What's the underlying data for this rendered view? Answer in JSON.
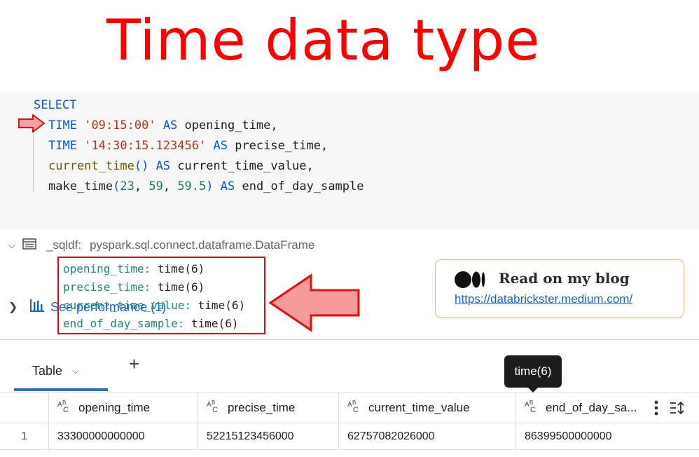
{
  "title": "Time data type",
  "code": {
    "select": "SELECT",
    "lines": [
      {
        "kw": "TIME",
        "str": "'09:15:00'",
        "as": "AS",
        "alias": "opening_time,"
      },
      {
        "kw": "TIME",
        "str": "'14:30:15.123456'",
        "as": "AS",
        "alias": "precise_time,"
      },
      {
        "fn": "current_time",
        "paren": "()",
        "as": "AS",
        "alias": "current_time_value,"
      },
      {
        "fn": "make_time",
        "open": "(",
        "args": [
          "23",
          "59",
          "59.5"
        ],
        "close": ")",
        "as": "AS",
        "alias": "end_of_day_sample"
      }
    ]
  },
  "see_performance": "See performance (1)",
  "dataframe": {
    "name": "_sqldf:",
    "type": "pyspark.sql.connect.dataframe.DataFrame"
  },
  "schema": [
    {
      "name": "opening_time:",
      "type": " time(6)"
    },
    {
      "name": "precise_time:",
      "type": " time(6)"
    },
    {
      "name": "current_time_value:",
      "type": " time(6)"
    },
    {
      "name": "end_of_day_sample:",
      "type": " time(6)"
    }
  ],
  "blog": {
    "read_label": "Read on my blog",
    "url": "https://databrickster.medium.com/"
  },
  "tabs": {
    "table_label": "Table"
  },
  "tooltip": "time(6)",
  "table": {
    "columns": [
      "opening_time",
      "precise_time",
      "current_time_value",
      "end_of_day_sa..."
    ],
    "rows": [
      {
        "index": "1",
        "values": [
          "33300000000000",
          "52215123456000",
          "62757082026000",
          "86399500000000"
        ]
      }
    ]
  },
  "colors": {
    "title": "#ff0000",
    "highlight": "#e01010",
    "link": "#1b63c7",
    "accent": "#2a6fba"
  }
}
